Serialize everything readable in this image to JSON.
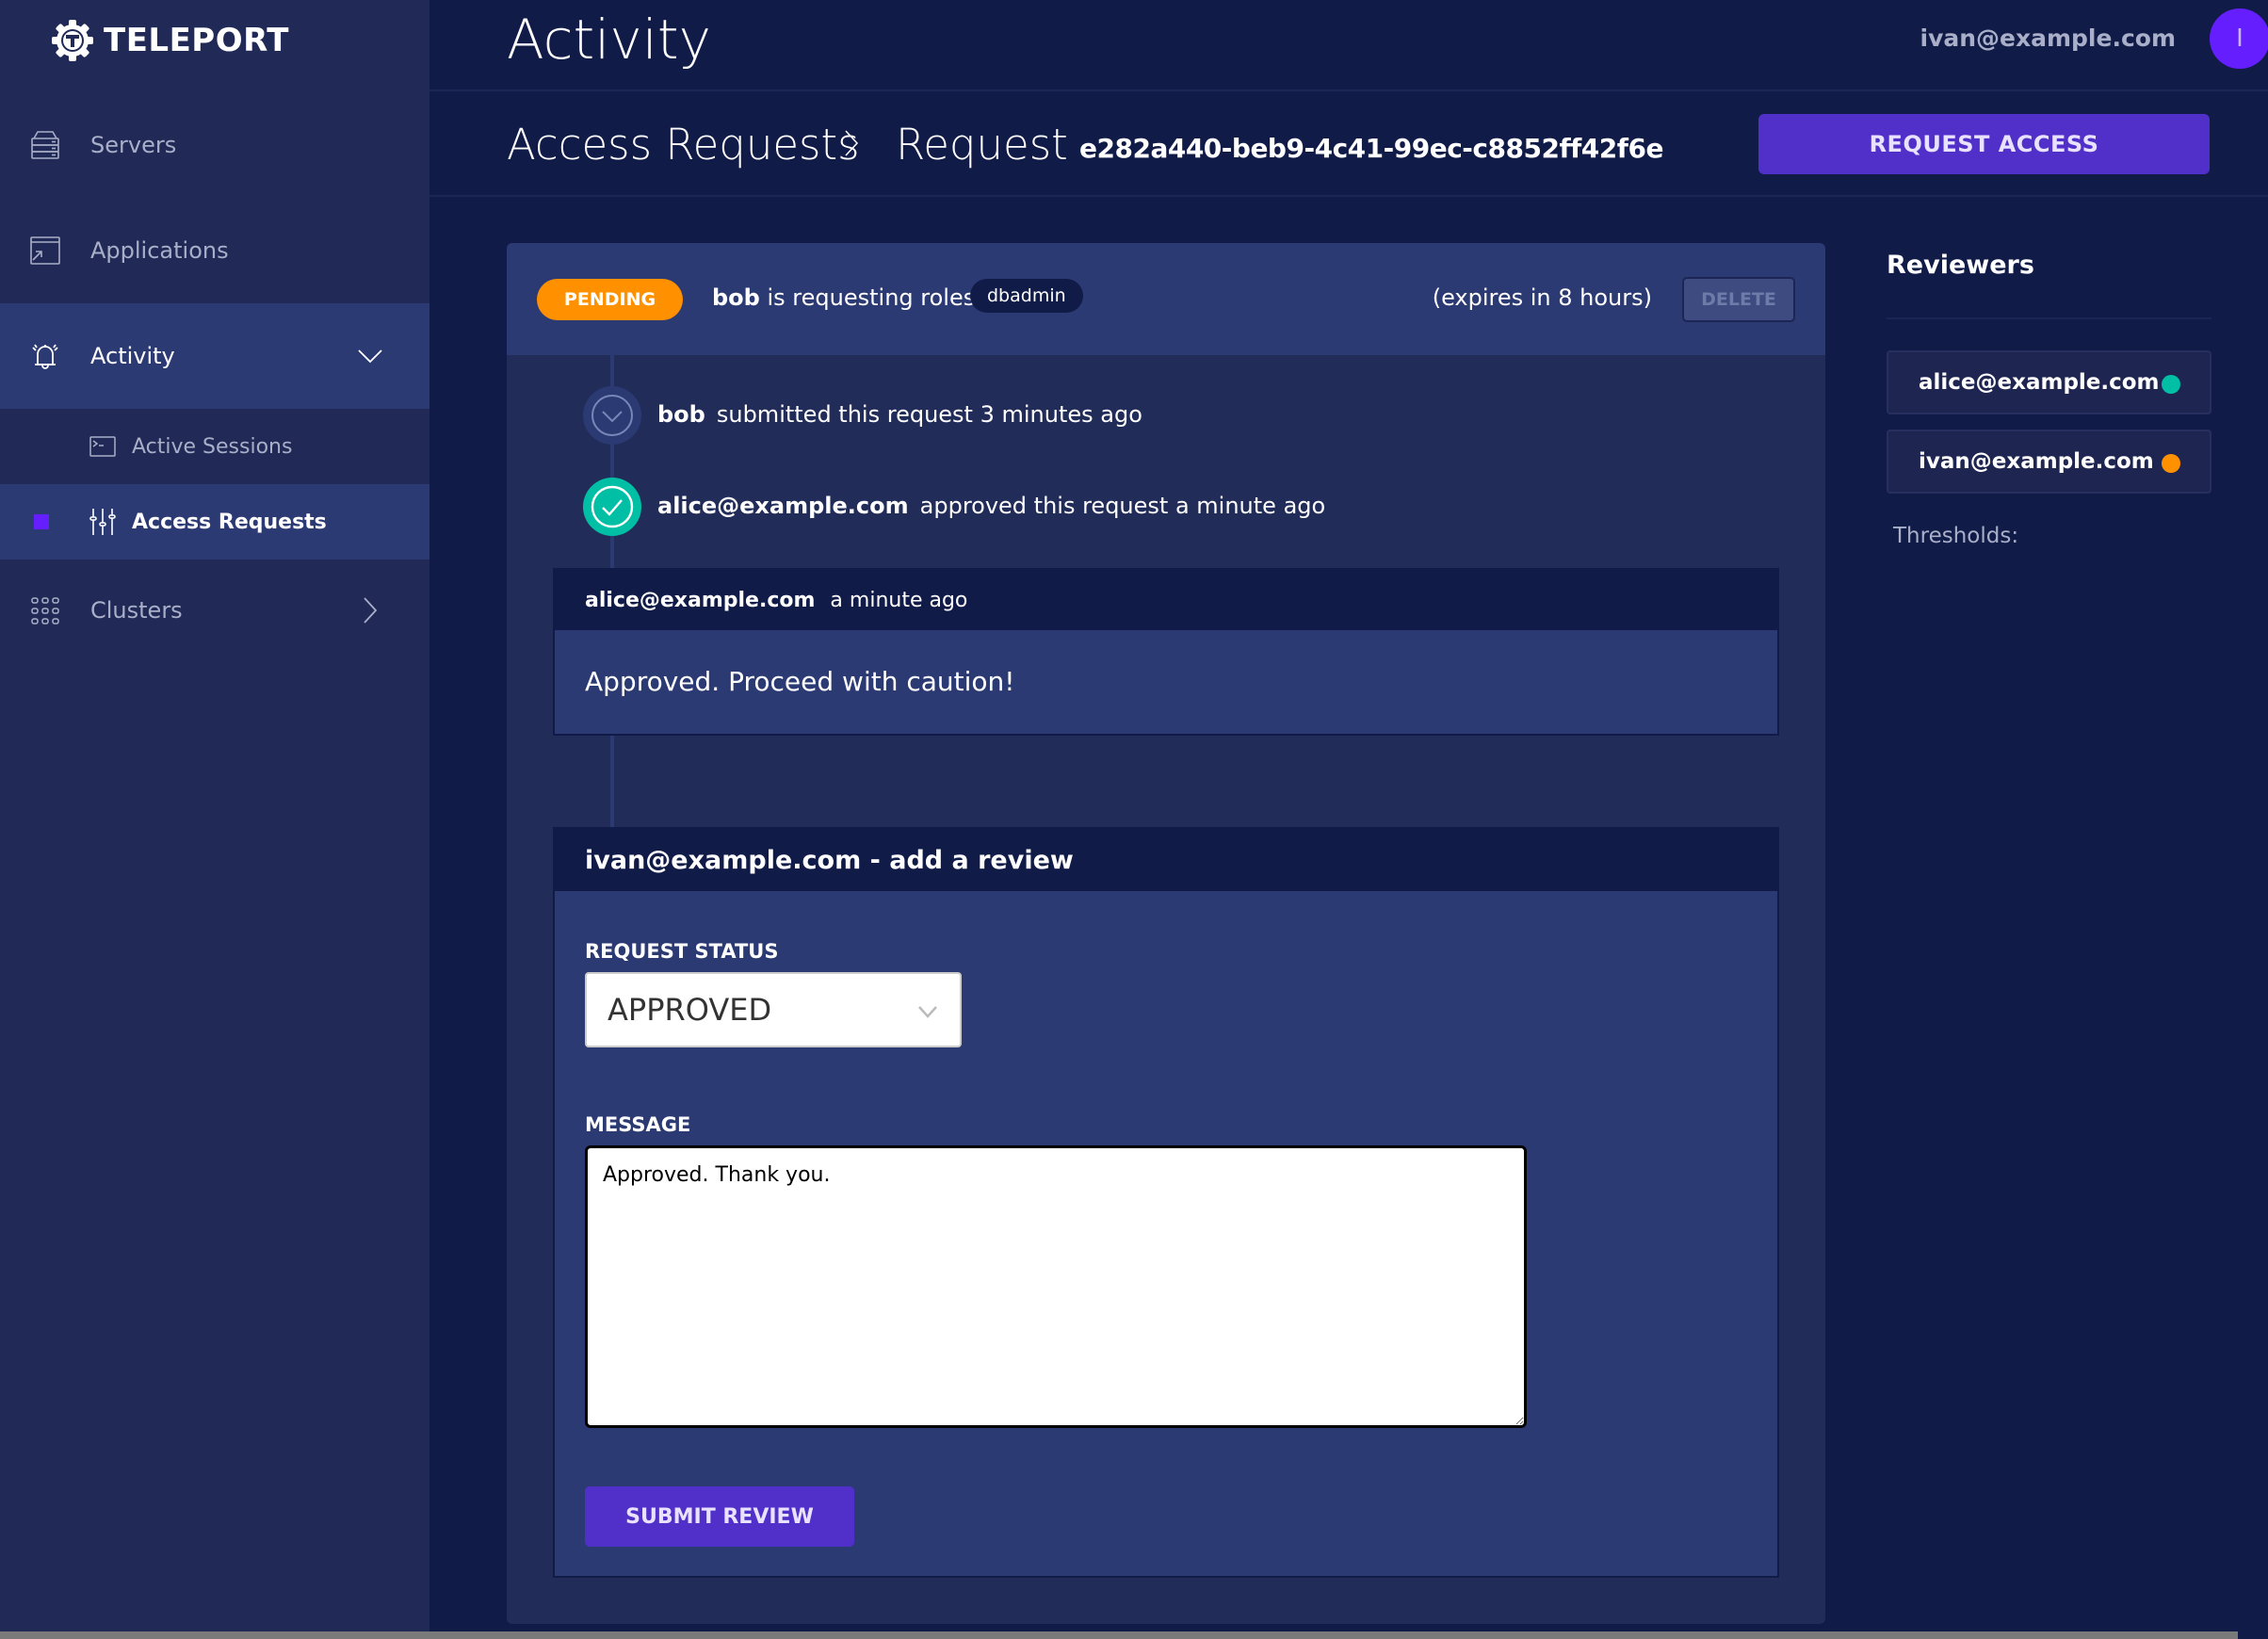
{
  "app": {
    "brand": "TELEPORT"
  },
  "sidebar": {
    "items": [
      {
        "label": "Servers",
        "icon": "server-icon"
      },
      {
        "label": "Applications",
        "icon": "application-icon"
      },
      {
        "label": "Activity",
        "icon": "bell-icon",
        "expanded": true
      },
      {
        "label": "Active Sessions",
        "icon": "terminal-icon"
      },
      {
        "label": "Access Requests",
        "icon": "sliders-icon",
        "active": true
      },
      {
        "label": "Clusters",
        "icon": "grid-icon"
      }
    ]
  },
  "header": {
    "title": "Activity",
    "user_email": "ivan@example.com",
    "avatar_initial": "I",
    "breadcrumb": {
      "parent": "Access Requests",
      "current": "Request",
      "request_id": "e282a440-beb9-4c41-99ec-c8852ff42f6e"
    },
    "request_access_label": "REQUEST ACCESS"
  },
  "request": {
    "status": "PENDING",
    "requester": "bob",
    "requesting_text": "is requesting roles:",
    "roles": [
      "dbadmin"
    ],
    "expires": "(expires in 8 hours)",
    "delete_label": "DELETE",
    "timeline": [
      {
        "user": "bob",
        "text": "submitted this request 3 minutes ago",
        "icon": "chevron-down-icon"
      },
      {
        "user": "alice@example.com",
        "text": "approved this request a minute ago",
        "icon": "check-icon"
      }
    ],
    "comment": {
      "user": "alice@example.com",
      "time": "a minute ago",
      "message": "Approved. Proceed with caution!"
    }
  },
  "review_form": {
    "title": "ivan@example.com - add a review",
    "status_label": "REQUEST STATUS",
    "status_value": "APPROVED",
    "message_label": "MESSAGE",
    "message_value": "Approved. Thank you.",
    "submit_label": "SUBMIT REVIEW"
  },
  "reviewers": {
    "title": "Reviewers",
    "list": [
      {
        "email": "alice@example.com",
        "status_color": "#00bfa5"
      },
      {
        "email": "ivan@example.com",
        "status_color": "#ff9100"
      }
    ],
    "thresholds_label": "Thresholds:"
  },
  "colors": {
    "accent": "#512fc9",
    "pending": "#ff9100",
    "approved": "#00bfa5",
    "active_marker": "#651fff"
  }
}
